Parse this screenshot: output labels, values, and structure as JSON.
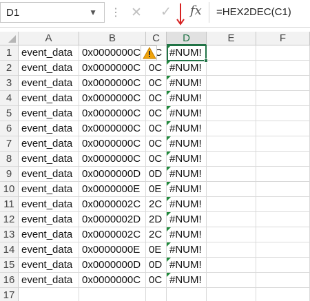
{
  "formula_bar": {
    "name_box": "D1",
    "cancel_glyph": "✕",
    "enter_glyph": "✓",
    "fx_label": "fx",
    "formula": "=HEX2DEC(C1)"
  },
  "columns": [
    "A",
    "B",
    "C",
    "D",
    "E",
    "F"
  ],
  "active_column": "D",
  "rows": [
    {
      "n": "1",
      "a": "event_data",
      "b": "0x0000000C",
      "c": "0C",
      "d": "#NUM!"
    },
    {
      "n": "2",
      "a": "event_data",
      "b": "0x0000000C",
      "c": "0C",
      "d": "#NUM!"
    },
    {
      "n": "3",
      "a": "event_data",
      "b": "0x0000000C",
      "c": "0C",
      "d": "#NUM!"
    },
    {
      "n": "4",
      "a": "event_data",
      "b": "0x0000000C",
      "c": "0C",
      "d": "#NUM!"
    },
    {
      "n": "5",
      "a": "event_data",
      "b": "0x0000000C",
      "c": "0C",
      "d": "#NUM!"
    },
    {
      "n": "6",
      "a": "event_data",
      "b": "0x0000000C",
      "c": "0C",
      "d": "#NUM!"
    },
    {
      "n": "7",
      "a": "event_data",
      "b": "0x0000000C",
      "c": "0C",
      "d": "#NUM!"
    },
    {
      "n": "8",
      "a": "event_data",
      "b": "0x0000000C",
      "c": "0C",
      "d": "#NUM!"
    },
    {
      "n": "9",
      "a": "event_data",
      "b": "0x0000000D",
      "c": "0D",
      "d": "#NUM!"
    },
    {
      "n": "10",
      "a": "event_data",
      "b": "0x0000000E",
      "c": "0E",
      "d": "#NUM!"
    },
    {
      "n": "11",
      "a": "event_data",
      "b": "0x0000002C",
      "c": "2C",
      "d": "#NUM!"
    },
    {
      "n": "12",
      "a": "event_data",
      "b": "0x0000002D",
      "c": "2D",
      "d": "#NUM!"
    },
    {
      "n": "13",
      "a": "event_data",
      "b": "0x0000002C",
      "c": "2C",
      "d": "#NUM!"
    },
    {
      "n": "14",
      "a": "event_data",
      "b": "0x0000000E",
      "c": "0E",
      "d": "#NUM!"
    },
    {
      "n": "15",
      "a": "event_data",
      "b": "0x0000000D",
      "c": "0D",
      "d": "#NUM!"
    },
    {
      "n": "16",
      "a": "event_data",
      "b": "0x0000000C",
      "c": "0C",
      "d": "#NUM!"
    },
    {
      "n": "17",
      "a": "",
      "b": "",
      "c": "",
      "d": ""
    }
  ],
  "colors": {
    "accent": "#217346",
    "error_flag": "#1e8a3a",
    "annotation_arrow": "#d62222",
    "warning": "#f0a30a"
  }
}
